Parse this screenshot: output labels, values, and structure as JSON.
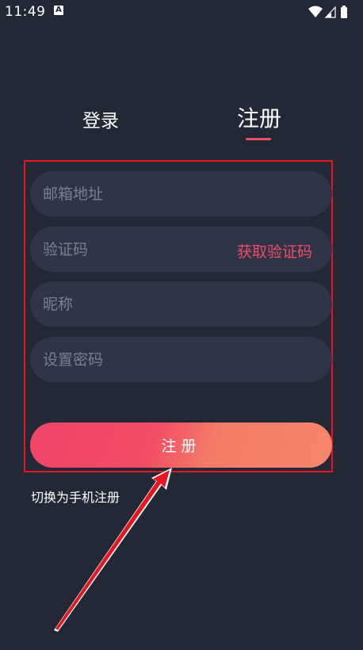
{
  "status_bar": {
    "time": "11:49",
    "notification_icon_letter": "A",
    "icons": [
      "notification-a-icon",
      "wifi-icon",
      "cellular-signal-icon",
      "battery-icon"
    ]
  },
  "tabs": [
    {
      "label": "登录",
      "active": false
    },
    {
      "label": "注册",
      "active": true
    }
  ],
  "form": {
    "email_placeholder": "邮箱地址",
    "code_placeholder": "验证码",
    "get_code_label": "获取验证码",
    "nickname_placeholder": "昵称",
    "password_placeholder": "设置密码",
    "submit_label": "注册"
  },
  "switch_link": "切换为手机注册",
  "colors": {
    "background": "#232837",
    "field_background": "#2f3547",
    "accent": "#f14a6a",
    "button_gradient_start": "#f04369",
    "button_gradient_end": "#f5866a",
    "annotation_red": "#e8141e"
  }
}
